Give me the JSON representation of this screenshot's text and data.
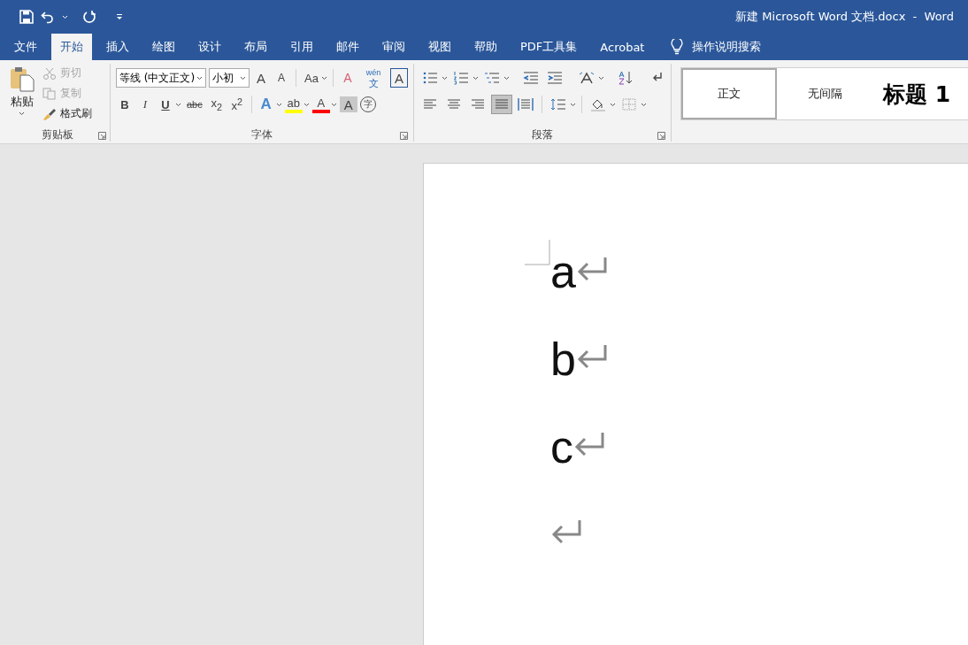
{
  "window": {
    "title": "新建 Microsoft Word 文档.docx  -  Word"
  },
  "tabs": [
    {
      "label": "文件",
      "selected": false
    },
    {
      "label": "开始",
      "selected": true
    },
    {
      "label": "插入",
      "selected": false
    },
    {
      "label": "绘图",
      "selected": false
    },
    {
      "label": "设计",
      "selected": false
    },
    {
      "label": "布局",
      "selected": false
    },
    {
      "label": "引用",
      "selected": false
    },
    {
      "label": "邮件",
      "selected": false
    },
    {
      "label": "审阅",
      "selected": false
    },
    {
      "label": "视图",
      "selected": false
    },
    {
      "label": "帮助",
      "selected": false
    },
    {
      "label": "PDF工具集",
      "selected": false
    },
    {
      "label": "Acrobat",
      "selected": false
    }
  ],
  "tell_me": {
    "label": "操作说明搜索"
  },
  "clipboard": {
    "label": "剪贴板",
    "paste": "粘贴",
    "items": [
      {
        "kind": "cut",
        "label": "剪切",
        "disabled": true
      },
      {
        "kind": "copy",
        "label": "复制",
        "disabled": true
      },
      {
        "kind": "painter",
        "label": "格式刷",
        "disabled": false
      }
    ]
  },
  "font": {
    "label": "字体",
    "font_name": "等线 (中文正文)",
    "font_size": "小初",
    "row1": [
      {
        "kind": "grow",
        "label": "A",
        "dropdown": false
      },
      {
        "kind": "shrink",
        "label": "A",
        "dropdown": false
      },
      {
        "kind": "case",
        "label": "Aa",
        "dropdown": true
      },
      {
        "kind": "clear",
        "label": "A",
        "dropdown": false
      },
      {
        "kind": "phonetic",
        "label": "wén$_{文}$",
        "dropdown": false
      },
      {
        "kind": "border",
        "label": "A",
        "dropdown": false
      }
    ],
    "row2": [
      {
        "kind": "bold",
        "label": "B",
        "dropdown": false
      },
      {
        "kind": "italic",
        "label": "I",
        "dropdown": false
      },
      {
        "kind": "underline",
        "label": "U",
        "dropdown": true
      },
      {
        "kind": "strike",
        "label": "abc",
        "dropdown": false
      },
      {
        "kind": "plain",
        "label": "x$_{2}$",
        "dropdown": false
      },
      {
        "kind": "plain",
        "label": "x$^{2}$",
        "dropdown": false
      },
      {
        "kind": "effects",
        "label": "A",
        "dropdown": true
      },
      {
        "kind": "color",
        "label": "ab",
        "color": "#ffff00",
        "dropdown": true
      },
      {
        "kind": "color",
        "label": "A",
        "color": "#ff0000",
        "dropdown": true
      },
      {
        "kind": "shade",
        "label": "A",
        "dropdown": false
      },
      {
        "kind": "circle",
        "label": "字",
        "dropdown": false
      }
    ]
  },
  "paragraph": {
    "label": "段落",
    "row1": [
      {
        "kind": "bullets",
        "dropdown": true,
        "selected": false
      },
      {
        "kind": "numbering",
        "dropdown": true,
        "selected": false
      },
      {
        "kind": "multilevel",
        "dropdown": true,
        "selected": false
      },
      {
        "kind": "outdent",
        "dropdown": false,
        "selected": false
      },
      {
        "kind": "indent",
        "dropdown": false,
        "selected": false
      },
      {
        "kind": "direction",
        "dropdown": true,
        "selected": false
      },
      {
        "kind": "sort",
        "dropdown": false,
        "selected": false
      },
      {
        "kind": "marks",
        "dropdown": false,
        "selected": false
      }
    ],
    "row2": [
      {
        "kind": "left",
        "dropdown": false,
        "selected": false
      },
      {
        "kind": "center",
        "dropdown": false,
        "selected": false
      },
      {
        "kind": "right",
        "dropdown": false,
        "selected": false
      },
      {
        "kind": "justify",
        "dropdown": false,
        "selected": true
      },
      {
        "kind": "distribute",
        "dropdown": false,
        "selected": false
      },
      {
        "kind": "spacing",
        "dropdown": true,
        "selected": false
      },
      {
        "kind": "shading",
        "dropdown": true,
        "selected": false
      },
      {
        "kind": "borders",
        "dropdown": true,
        "selected": false
      }
    ]
  },
  "styles": [
    {
      "label": "正文",
      "kind": "normal",
      "selected": true
    },
    {
      "label": "无间隔",
      "kind": "normal",
      "selected": false
    },
    {
      "label": "标题 1",
      "kind": "heading",
      "selected": false
    }
  ],
  "document": {
    "paragraphs": [
      {
        "kind": "text",
        "text": "a"
      },
      {
        "kind": "text",
        "text": "b"
      },
      {
        "kind": "text",
        "text": "c"
      },
      {
        "kind": "empty"
      }
    ]
  }
}
